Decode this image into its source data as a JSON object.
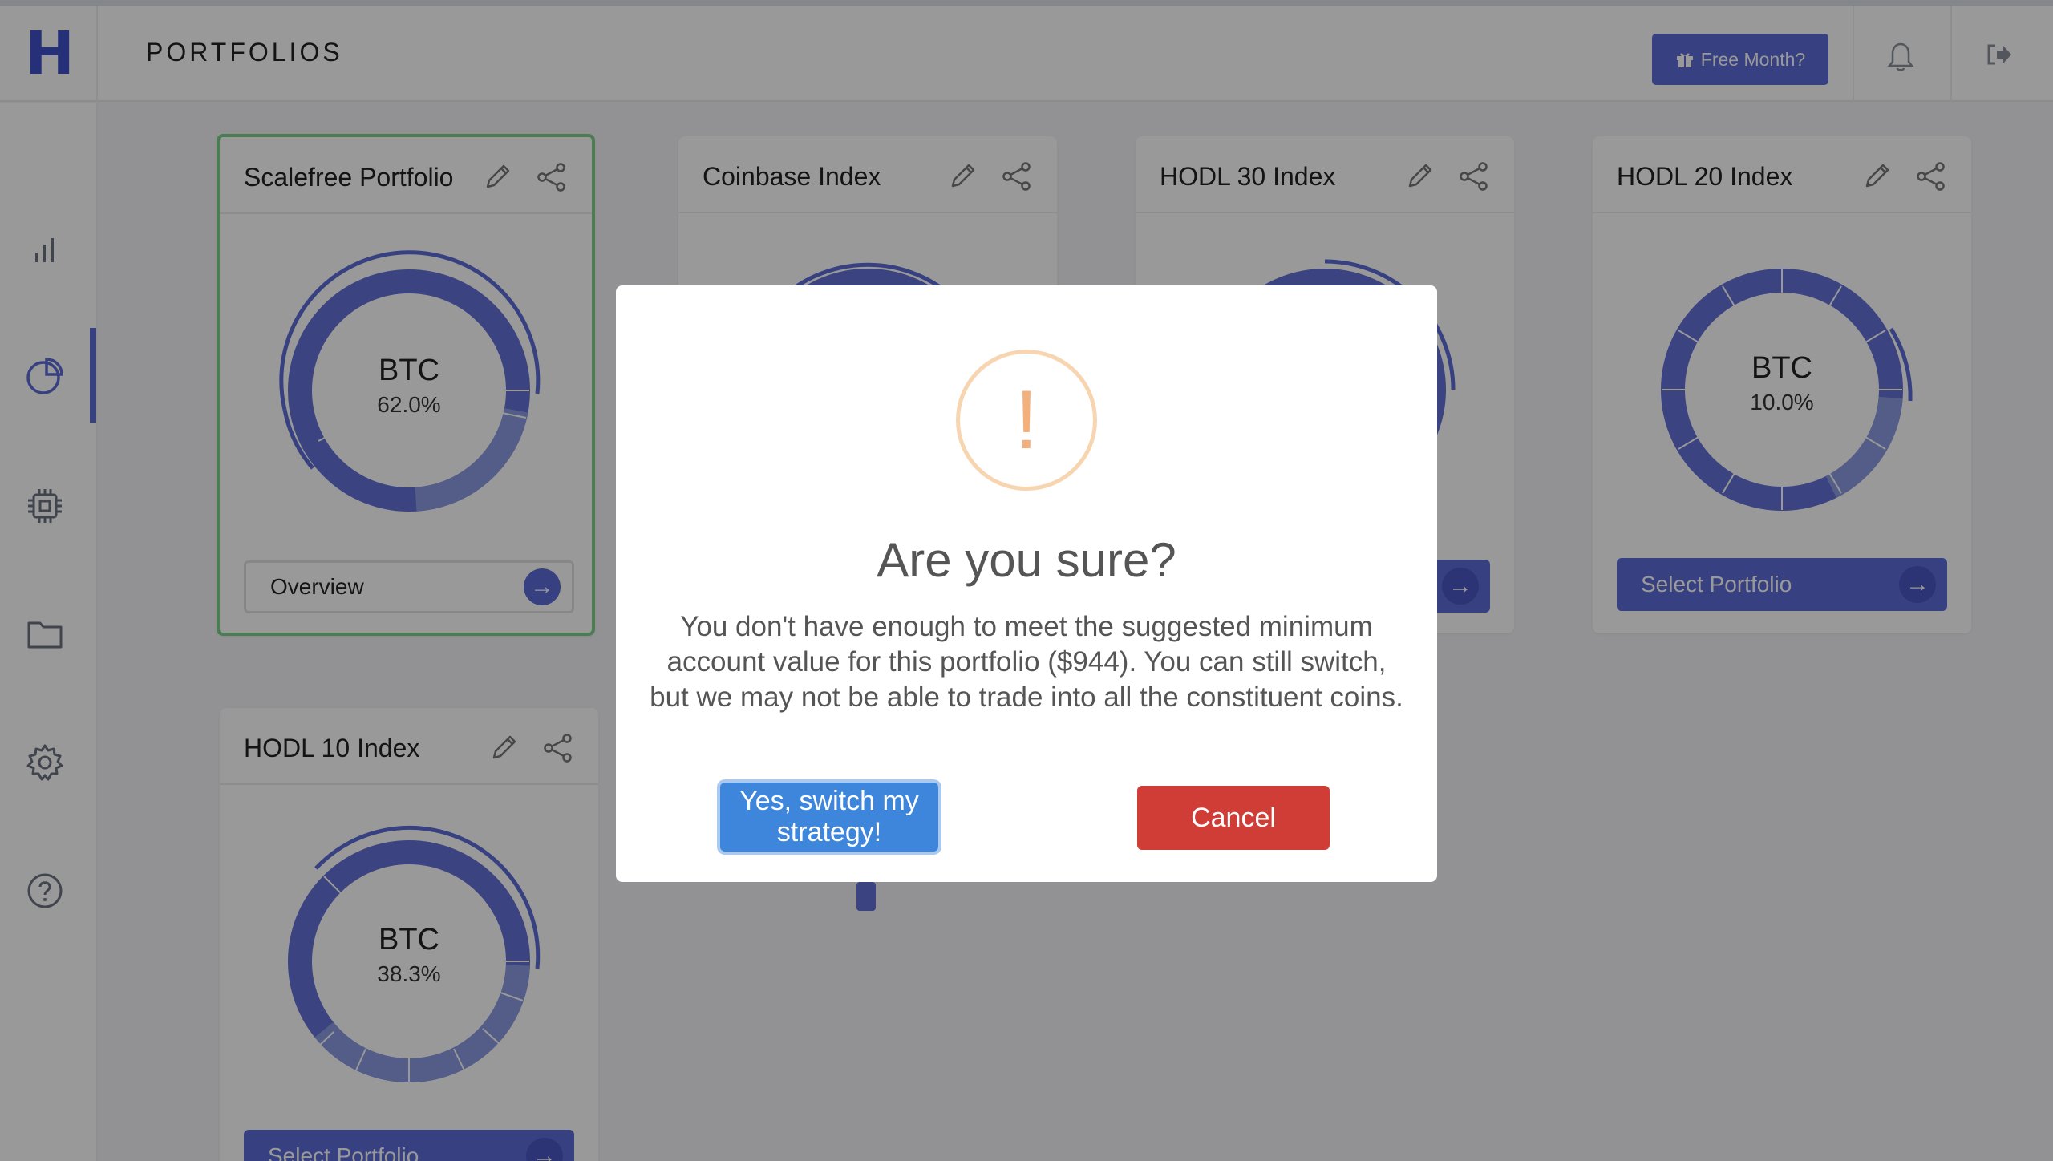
{
  "header": {
    "logo": "H",
    "title": "PORTFOLIOS",
    "free_month_label": "Free Month?",
    "icons": [
      "gift-icon",
      "bell-icon",
      "logout-icon"
    ]
  },
  "sidebar": {
    "items": [
      {
        "name": "stats",
        "icon": "bar-chart-icon"
      },
      {
        "name": "portfolios",
        "icon": "pie-chart-icon",
        "active": true
      },
      {
        "name": "chip",
        "icon": "chip-icon"
      },
      {
        "name": "files",
        "icon": "folder-icon"
      },
      {
        "name": "settings",
        "icon": "gear-icon"
      },
      {
        "name": "help",
        "icon": "help-icon"
      }
    ]
  },
  "cards": [
    {
      "title": "Scalefree Portfolio",
      "ticker": "BTC",
      "pct": "62.0%",
      "button": "Overview",
      "selected": true
    },
    {
      "title": "Coinbase Index",
      "ticker": "",
      "pct": "",
      "button": "",
      "selected": false
    },
    {
      "title": "HODL 30 Index",
      "ticker": "",
      "pct": "",
      "button": "",
      "selected": false
    },
    {
      "title": "HODL 20 Index",
      "ticker": "BTC",
      "pct": "10.0%",
      "button": "Select Portfolio",
      "selected": false
    },
    {
      "title": "HODL 10 Index",
      "ticker": "BTC",
      "pct": "38.3%",
      "button": "Select Portfolio",
      "selected": false
    }
  ],
  "modal": {
    "icon": "!",
    "title": "Are you sure?",
    "text": "You don't have enough to meet the suggested minimum account value for this portfolio ($944). You can still switch, but we may not be able to trade into all the constituent coins.",
    "confirm_label": "Yes, switch my strategy!",
    "cancel_label": "Cancel"
  },
  "colors": {
    "accent": "#5c6bd6",
    "selected_border": "#7fcf88",
    "confirm": "#3d86dc",
    "cancel": "#d03c36",
    "warning": "#f4b07c"
  }
}
